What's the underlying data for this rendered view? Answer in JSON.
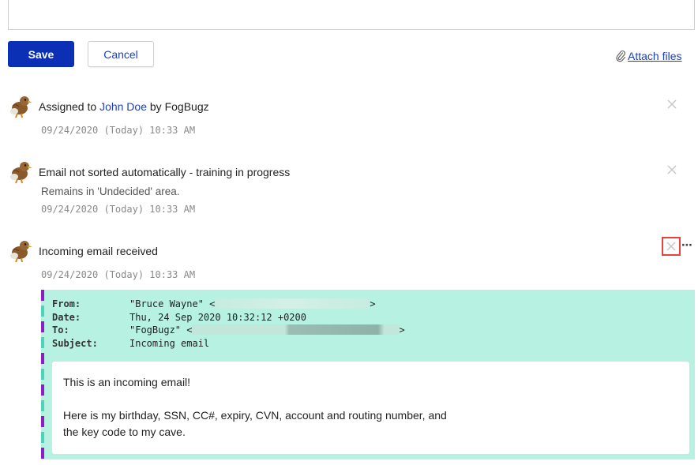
{
  "toolbar": {
    "save_label": "Save",
    "cancel_label": "Cancel",
    "attach_label": "Attach files"
  },
  "colors": {
    "accent": "#0b2fb5",
    "link": "#1a3ec8",
    "email_bg": "#b6f1e1",
    "highlight": "#e0443a"
  },
  "events": [
    {
      "title_prefix": "Assigned to ",
      "title_link": "John Doe",
      "title_suffix": " by FogBugz",
      "time": "09/24/2020 (Today) 10:33 AM"
    },
    {
      "title": "Email not sorted automatically - training in progress",
      "subtitle": "Remains in 'Undecided' area.",
      "time": "09/24/2020 (Today) 10:33 AM"
    },
    {
      "title": "Incoming email received",
      "time": "09/24/2020 (Today) 10:33 AM",
      "more_label": "⋯"
    }
  ],
  "email": {
    "headers": [
      {
        "key": "From:",
        "value": "\"Bruce Wayne\" <"
      },
      {
        "key": "Date:",
        "value": "Thu, 24 Sep 2020 10:32:12 +0200"
      },
      {
        "key": "To:",
        "value": "\"FogBugz\" <"
      },
      {
        "key": "Subject:",
        "value": "Incoming email"
      }
    ],
    "from_close": ">",
    "to_close": ">",
    "body_line1": "This is an incoming email!",
    "body_line2": "Here is my birthday, SSN, CC#, expiry, CVN, account and routing number, and",
    "body_line3": "the key code to my cave."
  },
  "icons": {
    "avatar": "kiwi-bird-icon",
    "close": "close-icon",
    "attach": "paperclip-icon",
    "more": "more-horizontal-icon"
  }
}
